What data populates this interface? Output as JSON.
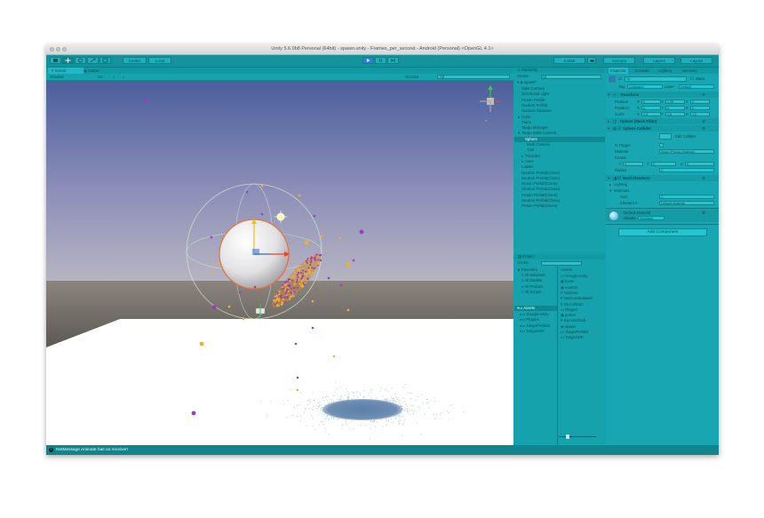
{
  "window": {
    "title": "Unity 5.6.0b8 Personal (64bit) - spawn.unity - Frames_per_second - Android (Personal) <OpenGL 4.1>"
  },
  "toolbar": {
    "pivot_label": "Center",
    "local_label": "Local",
    "collab_label": "Collab",
    "account_label": "Account",
    "layers_label": "Layers",
    "layout_label": "Layout"
  },
  "scene": {
    "tabs": [
      {
        "label": "Scene"
      },
      {
        "label": "Game"
      }
    ],
    "shading_mode": "Shaded",
    "mode_2d": "2D",
    "gizmos_label": "Gizmos",
    "search_placeholder": "All"
  },
  "hierarchy": {
    "tab_label": "Hierarchy",
    "create_label": "Create",
    "search_placeholder": "All",
    "scene_name": "spawn*",
    "items": [
      {
        "label": "Main Camera"
      },
      {
        "label": "Directional Light"
      },
      {
        "label": "Proton Prefab"
      },
      {
        "label": "Neutron Prefab"
      },
      {
        "label": "Nucleon Spawner"
      },
      {
        "label": "Cube"
      },
      {
        "label": "Plane"
      },
      {
        "label": "Tango Manager"
      },
      {
        "label": "Tango Delta Camera"
      },
      {
        "label": "Sphere"
      },
      {
        "label": "Multi Camera"
      },
      {
        "label": "Trail"
      },
      {
        "label": "Tricorder"
      },
      {
        "label": "Axes"
      },
      {
        "label": "Loader"
      },
      {
        "label": "Neutron Prefab(Clone)"
      },
      {
        "label": "Neutron Prefab(Clone)"
      },
      {
        "label": "Proton Prefab(Clone)"
      },
      {
        "label": "Neutron Prefab(Clone)"
      },
      {
        "label": "Proton Prefab(Clone)"
      },
      {
        "label": "Neutron Prefab(Clone)"
      },
      {
        "label": "Proton Prefab(Clone)"
      }
    ]
  },
  "project": {
    "tab_label": "Project",
    "create_label": "Create",
    "favorites_label": "Favorites",
    "favorites": [
      {
        "label": "All Materials"
      },
      {
        "label": "All Models"
      },
      {
        "label": "All Prefabs"
      },
      {
        "label": "All Scripts"
      }
    ],
    "assets_label": "Assets",
    "folders": [
      {
        "label": "Google-Unity"
      },
      {
        "label": "Plugins"
      },
      {
        "label": "TangoPrefabs"
      },
      {
        "label": "TangoSDK"
      }
    ],
    "breadcrumb": "Assets",
    "asset_items": [
      {
        "label": "Google-Unity"
      },
      {
        "label": "hover"
      },
      {
        "label": "neutron"
      },
      {
        "label": "Nucleon"
      },
      {
        "label": "NucleonSpawner"
      },
      {
        "label": "OnCollision"
      },
      {
        "label": "Plugins"
      },
      {
        "label": "proton"
      },
      {
        "label": "RemoteGrab"
      },
      {
        "label": "spawn"
      },
      {
        "label": "TangoPrefabs"
      },
      {
        "label": "TangoSDK"
      }
    ]
  },
  "inspector": {
    "tabs": [
      {
        "label": "Inspector"
      },
      {
        "label": "Console"
      },
      {
        "label": "Lighting"
      },
      {
        "label": "Services"
      }
    ],
    "object_name": "Sp",
    "static_label": "Static",
    "tag_label": "Tag",
    "tag_value": "Untagged",
    "layer_label": "Layer",
    "layer_value": "Default",
    "transform": {
      "title": "Transform",
      "rows": [
        {
          "label": "Position",
          "x": "0",
          "y": "1.95",
          "z": "0"
        },
        {
          "label": "Rotation",
          "x": "0",
          "y": "0",
          "z": "0"
        },
        {
          "label": "Scale",
          "x": "1.5",
          "y": "1.5",
          "z": "1.5"
        }
      ]
    },
    "mesh_filter_title": "Sphere (Mesh Filter)",
    "collider": {
      "title": "Sphere Collider",
      "edit_label": "Edit Collider",
      "is_trigger_label": "Is Trigger",
      "material_label": "Material",
      "material_value": "None (Physic Material)",
      "center_label": "Center",
      "center": {
        "x": "0",
        "y": "0",
        "z": "0"
      },
      "radius_label": "Radius",
      "radius_value": "2"
    },
    "mesh_renderer": {
      "title": "Mesh Renderer",
      "lighting_label": "Lighting",
      "materials_label": "Materials",
      "size_label": "Size",
      "size_value": "1",
      "element_label": "Element 0",
      "element_value": "Default-Material"
    },
    "material_name": "Default-Material",
    "shader_label": "Shader",
    "shader_value": "Standard",
    "add_component_label": "Add Component"
  },
  "status": {
    "message": "NetMessage Animate has no receiver!"
  },
  "colors": {
    "ui_teal": "#17a0aa",
    "sky_top": "#4b5f9c",
    "sky_horizon": "#b6b4c2",
    "ground_band": "#6c665f",
    "plane": "#ffffff",
    "sphere_outline": "#e9703b",
    "proton": "#9b3cc0",
    "neutron": "#f0b227",
    "shadow": "#6e8fb3"
  }
}
